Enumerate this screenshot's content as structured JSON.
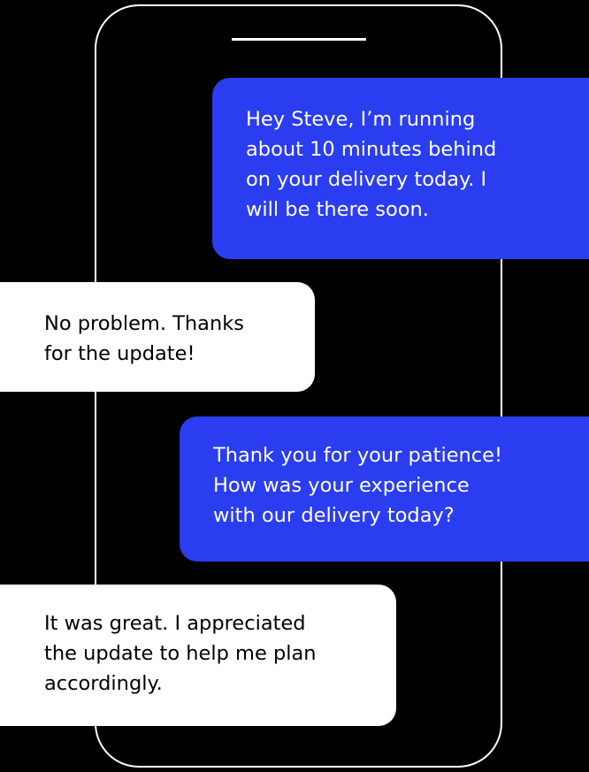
{
  "colors": {
    "background": "#000000",
    "phone_outline": "#ffffff",
    "outgoing_bubble": "#2a3df0",
    "incoming_bubble": "#ffffff"
  },
  "messages": [
    {
      "sender": "outgoing",
      "text": "Hey Steve, I’m running\nabout 10 minutes behind\non your delivery today. I\nwill be there soon."
    },
    {
      "sender": "incoming",
      "text": "No problem. Thanks\nfor the update!"
    },
    {
      "sender": "outgoing",
      "text": "Thank you for your patience!\nHow was your experience\nwith our delivery today?"
    },
    {
      "sender": "incoming",
      "text": "It was great. I appreciated\nthe update to help me plan\naccordingly."
    }
  ]
}
